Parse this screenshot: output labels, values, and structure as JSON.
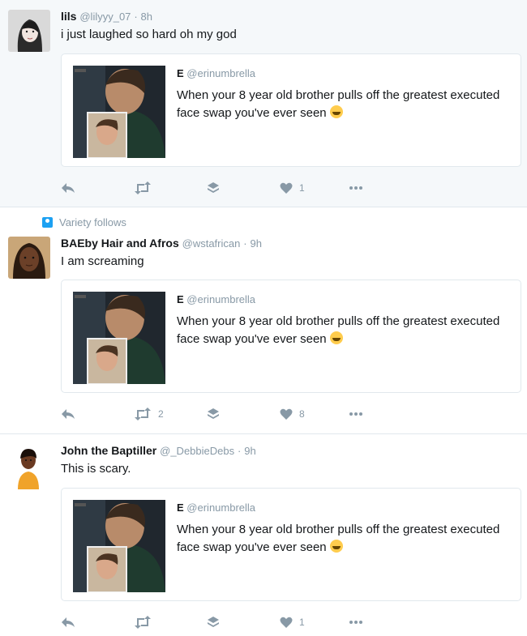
{
  "tweets": [
    {
      "name": "lils",
      "handle": "@lilyyy_07",
      "separator": "·",
      "time": "8h",
      "text": "i just laughed so hard oh my god",
      "context": "",
      "avatar_icon": "girl-photo-avatar",
      "quote": {
        "name": "E",
        "handle": "@erinumbrella",
        "text": "When your 8 year old brother pulls off the greatest executed face swap you've ever seen"
      },
      "retweets": "",
      "likes": "1"
    },
    {
      "name": "BAEby Hair and Afros",
      "handle": "@wstafrican",
      "separator": "·",
      "time": "9h",
      "text": "I am screaming",
      "context": "Variety follows",
      "avatar_icon": "person-photo-avatar",
      "quote": {
        "name": "E",
        "handle": "@erinumbrella",
        "text": "When your 8 year old brother pulls off the greatest executed face swap you've ever seen"
      },
      "retweets": "2",
      "likes": "8"
    },
    {
      "name": "John the Baptiller",
      "handle": "@_DebbieDebs",
      "separator": "·",
      "time": "9h",
      "text": "This is scary.",
      "context": "",
      "avatar_icon": "child-photo-avatar",
      "quote": {
        "name": "E",
        "handle": "@erinumbrella",
        "text": "When your 8 year old brother pulls off the greatest executed face swap you've ever seen"
      },
      "retweets": "",
      "likes": "1"
    }
  ],
  "colors": {
    "muted": "#8899a6",
    "text": "#14171a",
    "border": "#e1e8ed",
    "highlight_bg": "#f5f8fa",
    "accent": "#1da1f2"
  }
}
